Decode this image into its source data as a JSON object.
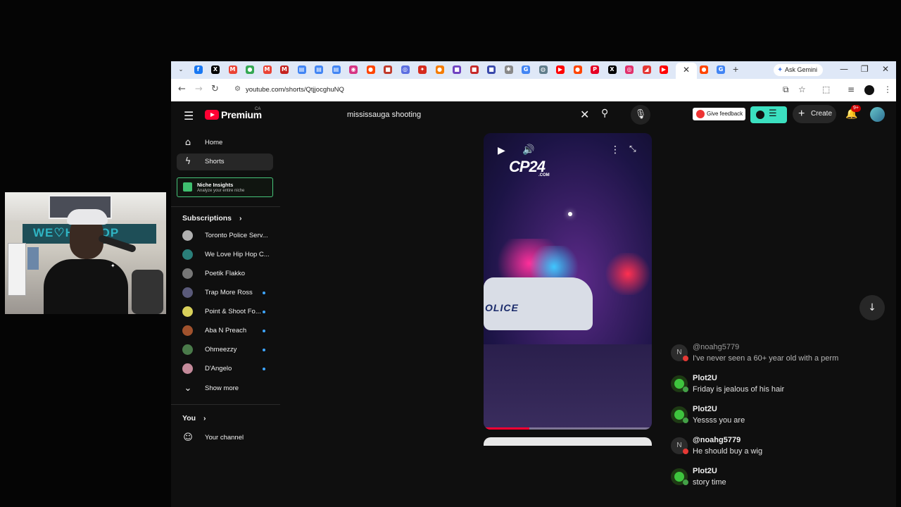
{
  "browser": {
    "tabs": [
      {
        "icon": "chevron-down-icon",
        "glyph": "⌄",
        "color": "#dfe8f7",
        "fg": "#444"
      },
      {
        "icon": "facebook-icon",
        "glyph": "f",
        "color": "#1877f2"
      },
      {
        "icon": "x-icon",
        "glyph": "X",
        "color": "#000000"
      },
      {
        "icon": "gmail-icon",
        "glyph": "M",
        "color": "#ea4335"
      },
      {
        "icon": "green-ext-icon",
        "glyph": "●",
        "color": "#34a853"
      },
      {
        "icon": "gmail-icon",
        "glyph": "M",
        "color": "#ea4335"
      },
      {
        "icon": "gmail-icon",
        "glyph": "M",
        "color": "#c5221f"
      },
      {
        "icon": "docs-icon",
        "glyph": "▤",
        "color": "#4285f4"
      },
      {
        "icon": "docs-icon",
        "glyph": "▤",
        "color": "#4285f4"
      },
      {
        "icon": "docs-icon",
        "glyph": "▤",
        "color": "#4285f4"
      },
      {
        "icon": "podcast-icon",
        "glyph": "◉",
        "color": "#d63384"
      },
      {
        "icon": "reddit-icon",
        "glyph": "●",
        "color": "#ff4500"
      },
      {
        "icon": "square-red-icon",
        "glyph": "■",
        "color": "#c0392b"
      },
      {
        "icon": "circle-blue-icon",
        "glyph": "◎",
        "color": "#5b6ee1"
      },
      {
        "icon": "maple-leaf-icon",
        "glyph": "✦",
        "color": "#d52b1e"
      },
      {
        "icon": "orange-circle-icon",
        "glyph": "●",
        "color": "#f57c00"
      },
      {
        "icon": "purple-icon",
        "glyph": "■",
        "color": "#6f42c1"
      },
      {
        "icon": "red-shield-icon",
        "glyph": "■",
        "color": "#c62828"
      },
      {
        "icon": "blue-square-icon",
        "glyph": "■",
        "color": "#3949ab"
      },
      {
        "icon": "gear-icon",
        "glyph": "✱",
        "color": "#888888"
      },
      {
        "icon": "google-icon",
        "glyph": "G",
        "color": "#4285f4"
      },
      {
        "icon": "globe-icon",
        "glyph": "◍",
        "color": "#607d8b"
      },
      {
        "icon": "youtube-icon",
        "glyph": "▶",
        "color": "#ff0000"
      },
      {
        "icon": "reddit-icon",
        "glyph": "●",
        "color": "#ff4500"
      },
      {
        "icon": "pinterest-icon",
        "glyph": "P",
        "color": "#e60023"
      },
      {
        "icon": "x-icon",
        "glyph": "X",
        "color": "#000000"
      },
      {
        "icon": "instagram-icon",
        "glyph": "◎",
        "color": "#e1306c"
      },
      {
        "icon": "red-link-icon",
        "glyph": "◢",
        "color": "#e53935"
      },
      {
        "icon": "youtube-icon",
        "glyph": "▶",
        "color": "#ff0000"
      }
    ],
    "active_tab_glyph": "✕",
    "after_tabs": [
      {
        "icon": "reddit-icon",
        "glyph": "●",
        "color": "#ff4500"
      },
      {
        "icon": "google-icon",
        "glyph": "G",
        "color": "#4285f4"
      }
    ],
    "new_tab": "+",
    "ask_gemini": "Ask Gemini",
    "window_controls": {
      "minimize": "—",
      "restore": "❐",
      "close": "✕"
    },
    "nav": {
      "back": "←",
      "forward": "→",
      "reload": "↻"
    },
    "url": "youtube.com/shorts/QtjjocghuNQ",
    "toolbar_icons": {
      "install": "⧉",
      "bookmark": "☆",
      "extensions": "⬚",
      "media": "≡",
      "menu": "⋮"
    }
  },
  "youtube": {
    "menu_glyph": "☰",
    "brand": "Premium",
    "region": "CA",
    "search": {
      "query": "mississauga shooting",
      "clear": "✕",
      "search_glyph": "⚲",
      "mic_glyph": "🎙"
    },
    "give_feedback": "Give feedback",
    "create": "Create",
    "bell_glyph": "🔔",
    "notif_count": "9+"
  },
  "sidebar": {
    "items": [
      {
        "label": "Home",
        "glyph": "⌂"
      },
      {
        "label": "Shorts",
        "glyph": "ϟ"
      }
    ],
    "niche": {
      "title": "Niche Insights",
      "subtitle": "Analyze your entire niche"
    },
    "subscriptions_title": "Subscriptions",
    "subscriptions": [
      {
        "label": "Toronto Police Serv...",
        "color": "#b0b0b0",
        "new": false
      },
      {
        "label": "We Love Hip Hop C...",
        "color": "#2a7f7a",
        "new": false
      },
      {
        "label": "Poetik Flakko",
        "color": "#777777",
        "new": false
      },
      {
        "label": "Trap More Ross",
        "color": "#5a5a7a",
        "new": true
      },
      {
        "label": "Point & Shoot Fo...",
        "color": "#d8d05a",
        "new": true
      },
      {
        "label": "Aba N Preach",
        "color": "#a0522d",
        "new": true
      },
      {
        "label": "Ohmeezzy",
        "color": "#4a7a4a",
        "new": true
      },
      {
        "label": "D'Angelo",
        "color": "#c48a9a",
        "new": true
      }
    ],
    "show_more": "Show more",
    "show_more_glyph": "⌄",
    "you": "You",
    "your_channel": "Your channel",
    "channel_glyph": "☺"
  },
  "player": {
    "logo": "CP24",
    "logo_suffix": ".COM",
    "car_text": "OLICE",
    "play_glyph": "▶",
    "volume_glyph": "🔊",
    "more_glyph": "⋮",
    "expand_glyph": "⤡",
    "progress": 0.27
  },
  "scroll_down_glyph": "↓",
  "chat": [
    {
      "user": "@noahg5779",
      "text": "I've never seen a 60+ year old with a perm",
      "initial": "N",
      "kind": "n",
      "dim": true
    },
    {
      "user": "Plot2U",
      "text": "Friday is jealous of his hair",
      "initial": "",
      "kind": "p",
      "dim": false
    },
    {
      "user": "Plot2U",
      "text": "Yessss you are",
      "initial": "",
      "kind": "p",
      "dim": false
    },
    {
      "user": "@noahg5779",
      "text": "He should buy a wig",
      "initial": "N",
      "kind": "n",
      "dim": false
    },
    {
      "user": "Plot2U",
      "text": "story time",
      "initial": "",
      "kind": "p",
      "dim": false
    }
  ],
  "webcam": {
    "banner": "WE♡HIP HOP"
  }
}
